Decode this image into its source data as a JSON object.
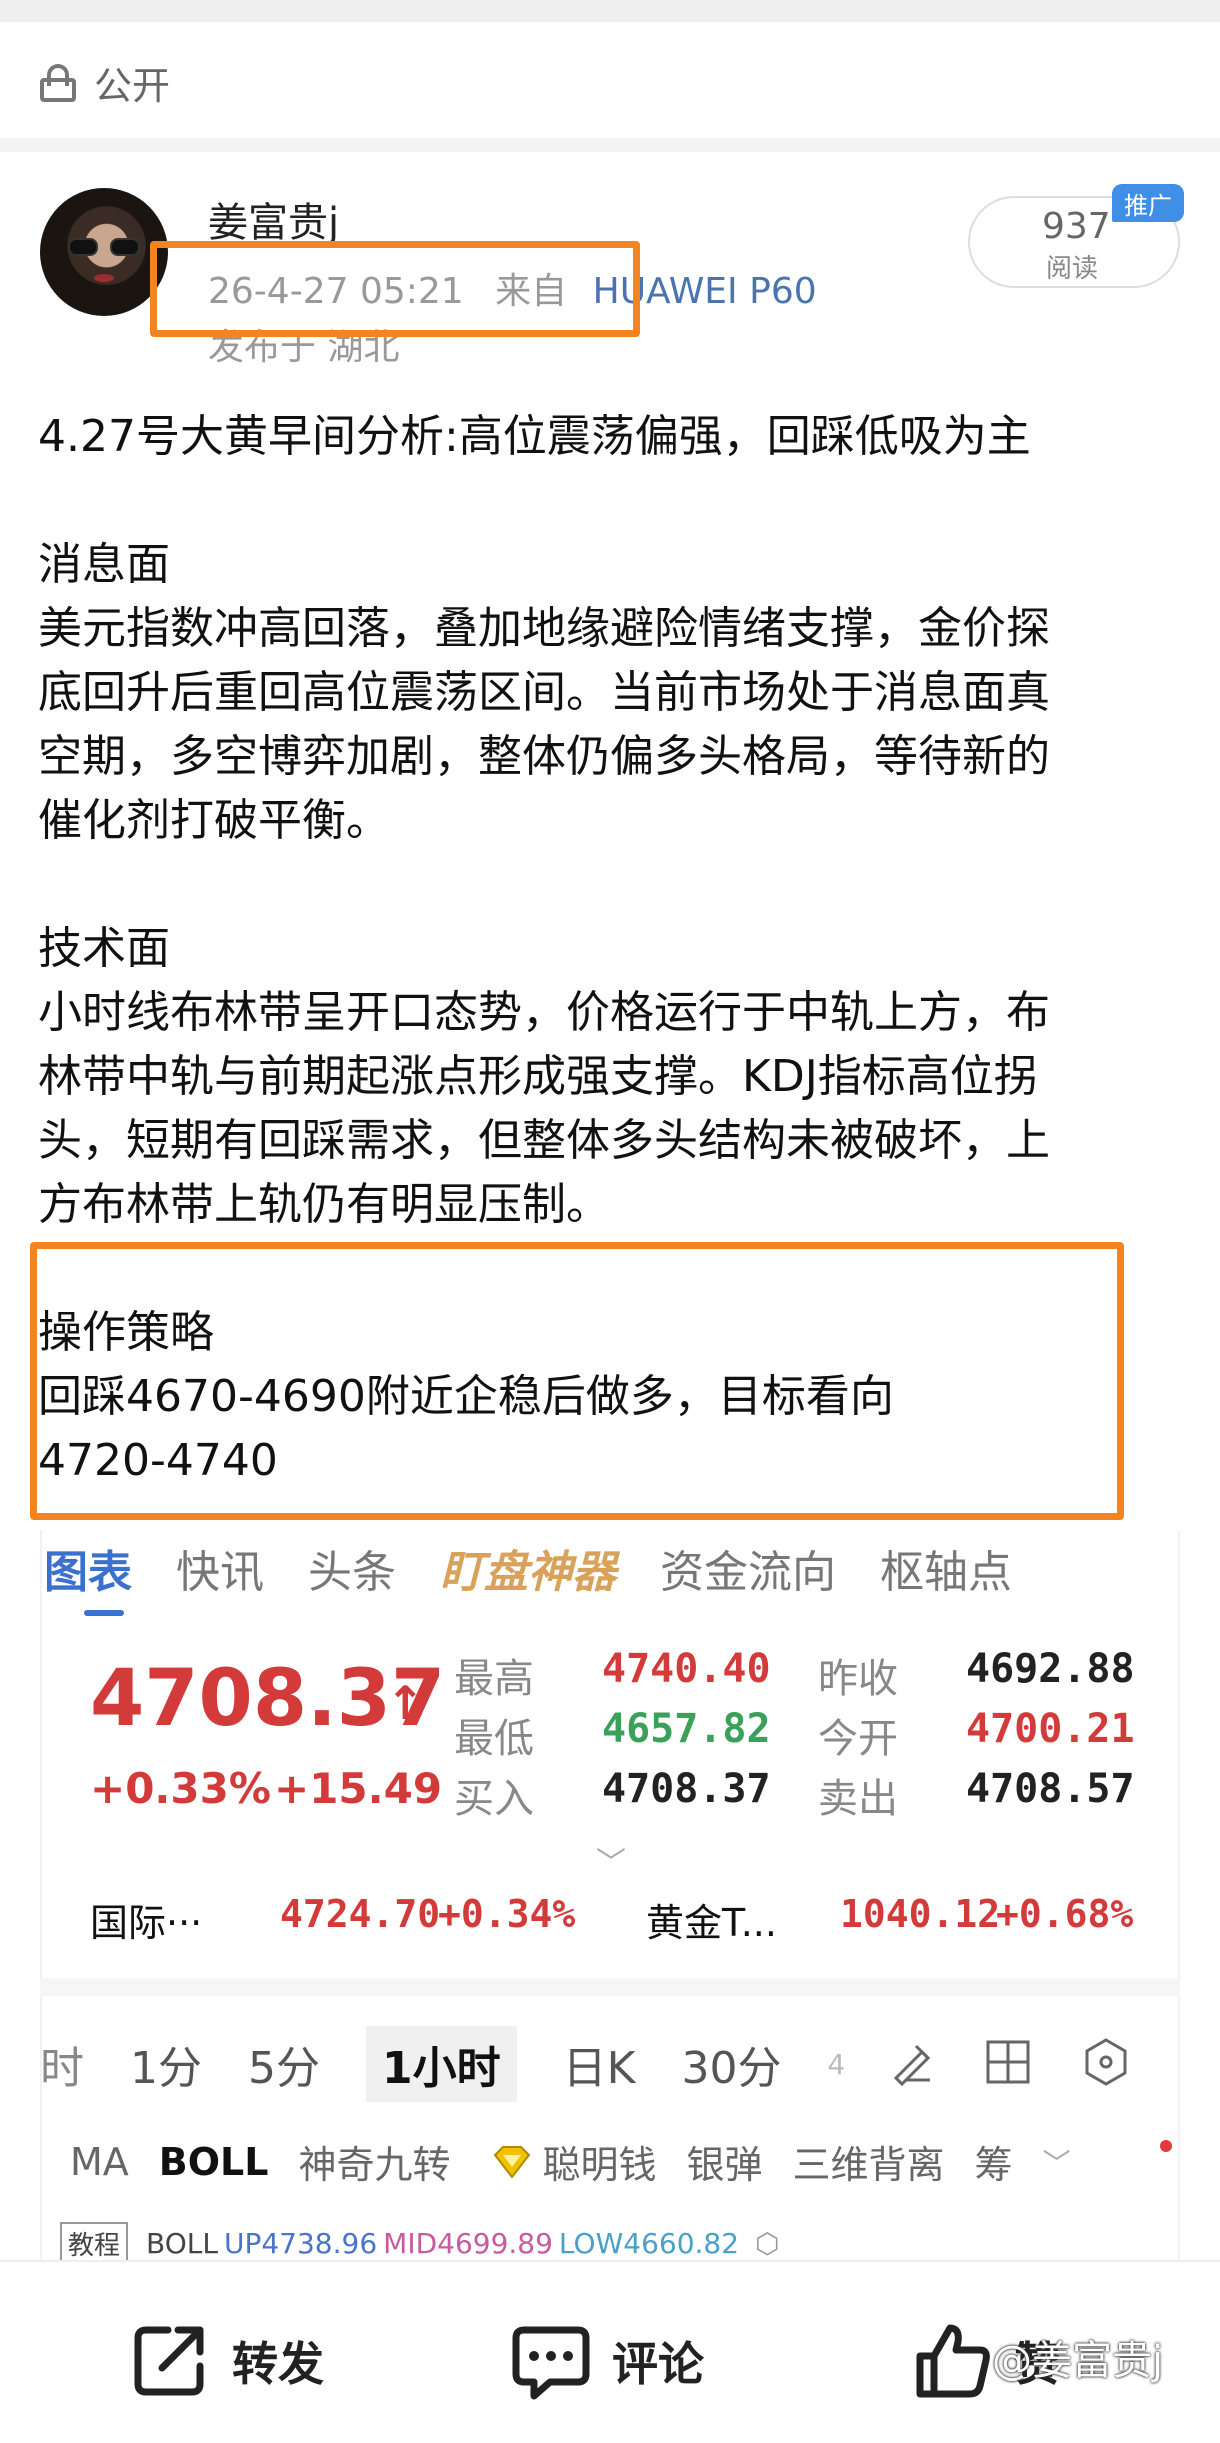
{
  "privacy": {
    "label": "公开",
    "icon": "lock-icon"
  },
  "author": {
    "name": "姜富贵j",
    "time": "26-4-27 05:21",
    "source_prefix": "来自",
    "device": "HUAWEI P60",
    "location": "发布于 湖北"
  },
  "stats": {
    "reads": "937",
    "reads_label": "阅读",
    "promo": "推广"
  },
  "post": {
    "title": "4.27号大黄早间分析:高位震荡偏强，回踩低吸为主",
    "news_heading": "消息面",
    "news_lines": [
      "美元指数冲高回落，叠加地缘避险情绪支撑，金价探",
      "底回升后重回高位震荡区间。当前市场处于消息面真",
      "空期，多空博弈加剧，整体仍偏多头格局，等待新的",
      "催化剂打破平衡。"
    ],
    "tech_heading": "技术面",
    "tech_lines": [
      "小时线布林带呈开口态势，价格运行于中轨上方，布",
      "林带中轨与前期起涨点形成强支撑。KDJ指标高位拐",
      "头，短期有回踩需求，但整体多头结构未被破坏，上",
      "方布林带上轨仍有明显压制。"
    ],
    "strategy_heading": "操作策略",
    "strategy_lines": [
      "回踩4670-4690附近企稳后做多，目标看向",
      "4720-4740"
    ]
  },
  "quote_card": {
    "tabs": [
      "图表",
      "快讯",
      "头条",
      "盯盘神器",
      "资金流向",
      "枢轴点"
    ],
    "price": "4708.37",
    "change_pct": "+0.33%",
    "change_abs": "+15.49",
    "fields": {
      "high_label": "最高",
      "high": "4740.40",
      "low_label": "最低",
      "low": "4657.82",
      "bid_label": "买入",
      "bid": "4708.37",
      "prev_label": "昨收",
      "prev": "4692.88",
      "open_label": "今开",
      "open": "4700.21",
      "ask_label": "卖出",
      "ask": "4708.57"
    },
    "related": [
      {
        "name": "国际···",
        "price": "4724.70",
        "pct": "+0.34%"
      },
      {
        "name": "黄金T...",
        "price": "1040.12",
        "pct": "+0.68%"
      }
    ],
    "periods": [
      "时",
      "1分",
      "5分",
      "1小时",
      "日K",
      "30分",
      "4"
    ],
    "selected_period": "1小时",
    "indicators": [
      "MA",
      "BOLL",
      "神奇九转",
      "聪明钱",
      "银弹",
      "三维背离",
      "筹"
    ],
    "tutorial": "教程",
    "boll": {
      "name": "BOLL",
      "up": "UP4738.96",
      "mid": "MID4699.89",
      "low": "LOW4660.82"
    },
    "colors": {
      "up": "#d33a3a",
      "down": "#3aa05a",
      "accent": "#3b6fd0",
      "highlight": "#f4841f"
    }
  },
  "actions": {
    "repost": "转发",
    "comment": "评论",
    "like": "赞"
  },
  "watermark": "@姜富贵j"
}
